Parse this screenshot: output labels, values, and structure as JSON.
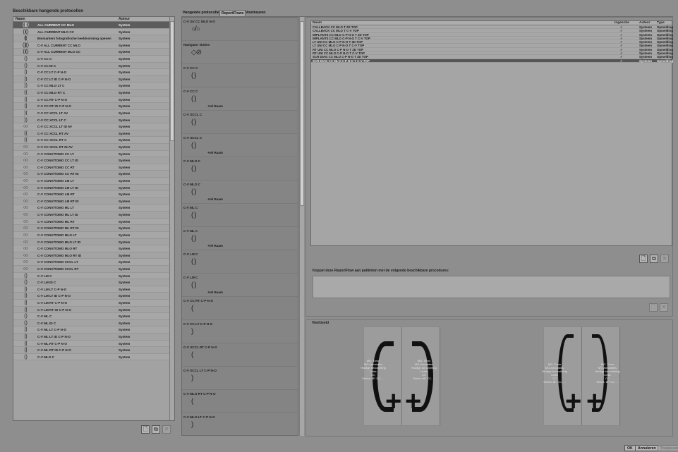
{
  "left": {
    "title": "Beschikbare hangende protocollen",
    "col_name": "Naam",
    "col_author": "Auteur",
    "rows": [
      {
        "icon": "( )|( )",
        "name": "ALL CURRENT CC MLO",
        "author": "System",
        "selected": true
      },
      {
        "icon": "( )( )",
        "name": "ALL CURRENT MLO CC",
        "author": "System"
      },
      {
        "icon": "(|( ",
        "name": "Biomarkers fotografische beeldvorming openen",
        "author": "System"
      },
      {
        "icon": "( )|( )",
        "name": "C-V ALL CURRENT CC MLO",
        "author": "System"
      },
      {
        "icon": "( )( )",
        "name": "C-V ALL CURRENT MLO CC",
        "author": "System"
      },
      {
        "icon": "( )",
        "name": "C-V CC C",
        "author": "System"
      },
      {
        "icon": "( )",
        "name": "C-V CC ID C",
        "author": "System"
      },
      {
        "icon": "| )",
        "name": "C-V CC LT C-P N-O",
        "author": "System"
      },
      {
        "icon": "| )",
        "name": "C-V CC LT ID C-P N-O",
        "author": "System"
      },
      {
        "icon": ") )",
        "name": "C-V CC MLO LT C",
        "author": "System"
      },
      {
        "icon": "( (",
        "name": "C-V CC MLO RT C",
        "author": "System"
      },
      {
        "icon": "( |",
        "name": "C-V CC RT C-P N-O",
        "author": "System"
      },
      {
        "icon": "( |",
        "name": "C-V CC RT ID C-P N-O",
        "author": "System"
      },
      {
        "icon": ") (",
        "name": "C-V CC XCCL LT AV",
        "author": "System"
      },
      {
        "icon": ") )",
        "name": "C-V CC XCCL LT C",
        "author": "System"
      },
      {
        "icon": "○○",
        "name": "C-V CC XCCL LT ID AV",
        "author": "System"
      },
      {
        "icon": "( (",
        "name": "C-V CC XCCL RT AV",
        "author": "System"
      },
      {
        "icon": "( (",
        "name": "C-V CC XCCL RT C",
        "author": "System"
      },
      {
        "icon": "○○",
        "name": "C-V CC XCCL RT ID AV",
        "author": "System"
      },
      {
        "icon": "○○",
        "name": "C-V CONV/TOMO CC LT",
        "author": "System"
      },
      {
        "icon": "○○",
        "name": "C-V CONV/TOMO CC LT ID",
        "author": "System"
      },
      {
        "icon": "○○",
        "name": "C-V CONV/TOMO CC RT",
        "author": "System"
      },
      {
        "icon": "○○",
        "name": "C-V CONV/TOMO CC RT ID",
        "author": "System"
      },
      {
        "icon": "○○",
        "name": "C-V CONV/TOMO LM LT",
        "author": "System"
      },
      {
        "icon": "○○",
        "name": "C-V CONV/TOMO LM LT ID",
        "author": "System"
      },
      {
        "icon": "○○",
        "name": "C-V CONV/TOMO LM RT",
        "author": "System"
      },
      {
        "icon": "○○",
        "name": "C-V CONV/TOMO LM RT ID",
        "author": "System"
      },
      {
        "icon": "○○",
        "name": "C-V CONV/TOMO ML LT",
        "author": "System"
      },
      {
        "icon": "○○",
        "name": "C-V CONV/TOMO ML LT ID",
        "author": "System"
      },
      {
        "icon": "○○",
        "name": "C-V CONV/TOMO ML RT",
        "author": "System"
      },
      {
        "icon": "○○",
        "name": "C-V CONV/TOMO ML RT ID",
        "author": "System"
      },
      {
        "icon": "○○",
        "name": "C-V CONV/TOMO MLO LT",
        "author": "System"
      },
      {
        "icon": "○○",
        "name": "C-V CONV/TOMO MLO LT ID",
        "author": "System"
      },
      {
        "icon": "○○",
        "name": "C-V CONV/TOMO MLO RT",
        "author": "System"
      },
      {
        "icon": "○○",
        "name": "C-V CONV/TOMO MLO RT ID",
        "author": "System"
      },
      {
        "icon": "○○",
        "name": "C-V CONV/TOMO XCCL LT",
        "author": "System"
      },
      {
        "icon": "○○",
        "name": "C-V CONV/TOMO XCCL RT",
        "author": "System"
      },
      {
        "icon": "( )",
        "name": "C-V LM C",
        "author": "System"
      },
      {
        "icon": "( )",
        "name": "C-V LM ID C",
        "author": "System"
      },
      {
        "icon": "| )",
        "name": "C-V LM LT C-P N-O",
        "author": "System"
      },
      {
        "icon": "| )",
        "name": "C-V LM LT ID C-P N-O",
        "author": "System"
      },
      {
        "icon": "( |",
        "name": "C-V LM RT C-P N-O",
        "author": "System"
      },
      {
        "icon": "( |",
        "name": "C-V LM RT ID C-P N-O",
        "author": "System"
      },
      {
        "icon": "( )",
        "name": "C-V ML C",
        "author": "System"
      },
      {
        "icon": "( )",
        "name": "C-V ML ID C",
        "author": "System"
      },
      {
        "icon": "| )",
        "name": "C-V ML LT C-P N-O",
        "author": "System"
      },
      {
        "icon": "| )",
        "name": "C-V ML LT ID C-P N-O",
        "author": "System"
      },
      {
        "icon": "( |",
        "name": "C-V ML RT C-P N-O",
        "author": "System"
      },
      {
        "icon": "( |",
        "name": "C-V ML RT ID C-P N-O",
        "author": "System"
      },
      {
        "icon": "( )",
        "name": "C-V MLO C",
        "author": "System"
      }
    ]
  },
  "tabs": [
    "Hangende protocollen",
    "ReportFlows",
    "Voorkeuren"
  ],
  "flow": [
    {
      "title": "C-V GV CC MLO N-O",
      "glyph": "○/○",
      "note": ""
    },
    {
      "title": "Navigator sluiten",
      "glyph": "◇⊘",
      "note": ""
    },
    {
      "title": "C-V CC C",
      "glyph": "( )",
      "note": ""
    },
    {
      "title": "C-V CC C",
      "glyph": "( )",
      "note": "+tel Raam"
    },
    {
      "title": "C-V XCCL C",
      "glyph": "( )",
      "note": ""
    },
    {
      "title": "C-V XCCL C",
      "glyph": "( )",
      "note": "+tel Raam"
    },
    {
      "title": "C-V MLO C",
      "glyph": "( )",
      "note": ""
    },
    {
      "title": "C-V MLO C",
      "glyph": "( )",
      "note": "+tel Raam"
    },
    {
      "title": "C-V ML C",
      "glyph": "( )",
      "note": ""
    },
    {
      "title": "C-V ML C",
      "glyph": "( )",
      "note": "+tel Raam"
    },
    {
      "title": "C-V LM C",
      "glyph": "( )",
      "note": ""
    },
    {
      "title": "C-V LM C",
      "glyph": "( )",
      "note": "+tel Raam"
    },
    {
      "title": "C-V CC RT C-P N-O",
      "glyph": "(",
      "note": ""
    },
    {
      "title": "C-V CC LT C-P N-O",
      "glyph": ")",
      "note": ""
    },
    {
      "title": "C-V XCCL RT C-P N-O",
      "glyph": "(",
      "note": ""
    },
    {
      "title": "C-V XCCL LT C-P N-O",
      "glyph": ")",
      "note": ""
    },
    {
      "title": "C-V MLO RT C-P N-O",
      "glyph": "(",
      "note": ""
    },
    {
      "title": "C-V MLO LT C-P N-O",
      "glyph": ")",
      "note": ""
    }
  ],
  "right": {
    "col_name": "Naam",
    "col_included": "Ingesche",
    "col_author": "Auteur",
    "col_type": "Type",
    "rows": [
      {
        "name": "CALLBACK CC MLO T 2D TOP",
        "check": "✓",
        "author": "Systeem",
        "type": "Opmelding"
      },
      {
        "name": "CALLBACK CC MLO T C-V TOP",
        "check": "✓",
        "author": "Systeem",
        "type": "Opmelding"
      },
      {
        "name": "IMPLANTS CC MLO C-P N-O T 2D TOP",
        "check": "✓",
        "author": "Systeem",
        "type": "Opmelding"
      },
      {
        "name": "IMPLANTS CC MLO C-P N-O T C-V TOP",
        "check": "✓",
        "author": "Systeem",
        "type": "Opmelding"
      },
      {
        "name": "LT UNI CC MLO C-P N-O T 2D TOP",
        "check": "✓",
        "author": "Systeem",
        "type": "Opmelding"
      },
      {
        "name": "LT UNI CC MLO C-P N-O T C-V TOP",
        "check": "✓",
        "author": "Systeem",
        "type": "Opmelding"
      },
      {
        "name": "RT UNI CC MLO C-P N-O T 2D TOP",
        "check": "✓",
        "author": "Systeem",
        "type": "Opmelding"
      },
      {
        "name": "RT UNI CC MLO C-P N-O T C-V TOP",
        "check": "✓",
        "author": "Systeem",
        "type": "Opmelding"
      },
      {
        "name": "SCR DIAG CC MLO C-P N-O T 2D TOP",
        "check": "✓",
        "author": "Systeem",
        "type": "Opmelding"
      },
      {
        "name": "SCR DIAG CC MLO C-P N-O T C-V TOP",
        "check": "✓",
        "author": "Systeem",
        "type": "Opmelding",
        "selected": true
      }
    ],
    "couple_label": "Koppel deze ReportFlow aan patiënten met de volgende beschikbare procedures:",
    "preview_label": "Voorbeeld",
    "preview_text": [
      "MG, Tomo",
      "MG Annotaties",
      "",
      "Huidige beoordeling",
      "Links",
      "CC",
      "Series: 8P, CC, ..."
    ]
  },
  "buttons": {
    "new": "🗋",
    "copy": "⧉",
    "delete": "✕",
    "ok": "OK",
    "cancel": "Annuleren",
    "apply": "Toepassen"
  }
}
